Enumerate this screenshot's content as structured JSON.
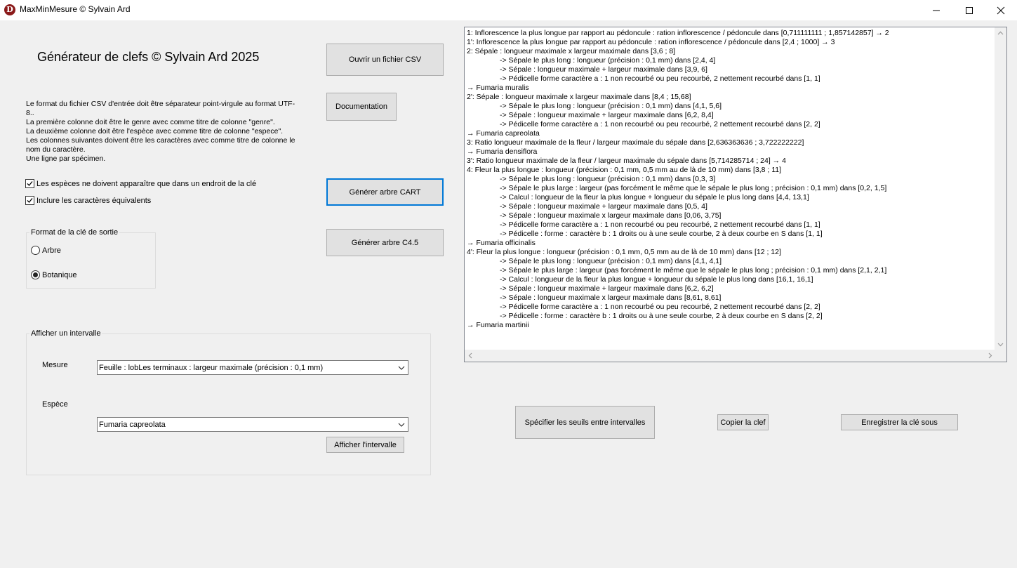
{
  "window": {
    "title": "MaxMinMesure © Sylvain Ard",
    "icon_letter": "D"
  },
  "header": {
    "title": "Générateur de clefs © Sylvain Ard 2025"
  },
  "buttons": {
    "open_csv": "Ouvrir un fichier CSV",
    "documentation": "Documentation",
    "generate_cart": "Générer arbre CART",
    "generate_c45": "Générer arbre C4.5",
    "show_interval": "Afficher l'intervalle",
    "specify_thresholds": "Spécifier les seuils entre intervalles",
    "copy_key": "Copier la clef",
    "save_key": "Enregistrer la clé sous"
  },
  "description": [
    "Le format du fichier CSV d'entrée doit être séparateur point-virgule au format UTF-8..",
    "La première colonne doit être le genre avec comme titre de colonne \"genre\".",
    "La deuxième colonne doit être l'espèce avec comme titre de colonne \"espece\".",
    "Les colonnes suivantes doivent être les caractères avec comme titre de colonne le nom du caractère.",
    "Une ligne par spécimen."
  ],
  "options": {
    "unique_species": {
      "label": "Les espèces ne doivent apparaître que dans un endroit de la clé",
      "checked": true
    },
    "equivalent_chars": {
      "label": "Inclure les caractères équivalents",
      "checked": true
    }
  },
  "output_format": {
    "title": "Format de la clé de sortie",
    "options": [
      {
        "label": "Arbre",
        "selected": false
      },
      {
        "label": "Botanique",
        "selected": true
      }
    ]
  },
  "interval": {
    "title": "Afficher un intervalle",
    "measure_label": "Mesure",
    "measure_value": "Feuille : lobLes terminaux : largeur maximale (précision : 0,1 mm)",
    "species_label": "Espèce",
    "species_value": "Fumaria capreolata"
  },
  "key_lines": [
    {
      "text": "1: Inflorescence la plus longue par rapport au pédoncule : ration inflorescence / pédoncule dans [0,711111111 ; 1,857142857] → 2",
      "indent": false
    },
    {
      "text": "1': Inflorescence la plus longue par rapport au pédoncule : ration inflorescence / pédoncule dans [2,4 ; 1000] → 3",
      "indent": false
    },
    {
      "text": "2: Sépale : longueur maximale x largeur maximale dans [3,6 ; 8]",
      "indent": false
    },
    {
      "text": "-> Sépale le plus long : longueur (précision : 0,1 mm) dans [2,4, 4]",
      "indent": true
    },
    {
      "text": "-> Sépale : longueur maximale + largeur maximale dans [3,9, 6]",
      "indent": true
    },
    {
      "text": "-> Pédicelle forme caractère a : 1 non recourbé ou peu recourbé, 2 nettement recourbé dans [1, 1]",
      "indent": true
    },
    {
      "text": "→ Fumaria muralis",
      "indent": false
    },
    {
      "text": "2': Sépale : longueur maximale x largeur maximale dans [8,4 ; 15,68]",
      "indent": false
    },
    {
      "text": "-> Sépale le plus long : longueur (précision : 0,1 mm) dans [4,1, 5,6]",
      "indent": true
    },
    {
      "text": "-> Sépale : longueur maximale + largeur maximale dans [6,2, 8,4]",
      "indent": true
    },
    {
      "text": "-> Pédicelle forme caractère a : 1 non recourbé ou peu recourbé, 2 nettement recourbé dans [2, 2]",
      "indent": true
    },
    {
      "text": "→ Fumaria capreolata",
      "indent": false
    },
    {
      "text": "3: Ratio longueur maximale de la fleur / largeur maximale du sépale dans [2,636363636 ; 3,722222222]",
      "indent": false
    },
    {
      "text": "→ Fumaria densiflora",
      "indent": false
    },
    {
      "text": "3': Ratio longueur maximale de la fleur / largeur maximale du sépale dans [5,714285714 ; 24] → 4",
      "indent": false
    },
    {
      "text": "4: Fleur la plus longue : longueur (précision : 0,1 mm, 0,5 mm au de là de 10 mm) dans [3,8 ; 11]",
      "indent": false
    },
    {
      "text": "-> Sépale le plus long : longueur (précision : 0,1 mm) dans [0,3, 3]",
      "indent": true
    },
    {
      "text": "-> Sépale le plus large : largeur (pas forcément le même que le sépale le plus long ; précision : 0,1 mm) dans [0,2, 1,5]",
      "indent": true
    },
    {
      "text": "-> Calcul : longueur de la fleur la plus longue + longueur du sépale le plus long dans [4,4, 13,1]",
      "indent": true
    },
    {
      "text": "-> Sépale : longueur maximale + largeur maximale dans [0,5, 4]",
      "indent": true
    },
    {
      "text": "-> Sépale : longueur maximale x largeur maximale dans [0,06, 3,75]",
      "indent": true
    },
    {
      "text": "-> Pédicelle forme caractère a : 1 non recourbé ou peu recourbé, 2 nettement recourbé dans [1, 1]",
      "indent": true
    },
    {
      "text": "-> Pédicelle : forme : caractère b : 1 droits ou à une seule courbe, 2 à deux courbe en S dans [1, 1]",
      "indent": true
    },
    {
      "text": "→ Fumaria officinalis",
      "indent": false
    },
    {
      "text": "4': Fleur la plus longue : longueur (précision : 0,1 mm, 0,5 mm au de là de 10 mm) dans [12 ; 12]",
      "indent": false
    },
    {
      "text": "-> Sépale le plus long : longueur (précision : 0,1 mm) dans [4,1, 4,1]",
      "indent": true
    },
    {
      "text": "-> Sépale le plus large : largeur (pas forcément le même que le sépale le plus long ; précision : 0,1 mm) dans [2,1, 2,1]",
      "indent": true
    },
    {
      "text": "-> Calcul : longueur de la fleur la plus longue + longueur du sépale le plus long dans [16,1, 16,1]",
      "indent": true
    },
    {
      "text": "-> Sépale : longueur maximale + largeur maximale dans [6,2, 6,2]",
      "indent": true
    },
    {
      "text": "-> Sépale : longueur maximale x largeur maximale dans [8,61, 8,61]",
      "indent": true
    },
    {
      "text": "-> Pédicelle forme caractère a : 1 non recourbé ou peu recourbé, 2 nettement recourbé dans [2, 2]",
      "indent": true
    },
    {
      "text": "-> Pédicelle : forme : caractère b : 1 droits ou à une seule courbe, 2 à deux courbe en S dans [2, 2]",
      "indent": true
    },
    {
      "text": "→ Fumaria martinii",
      "indent": false
    }
  ]
}
